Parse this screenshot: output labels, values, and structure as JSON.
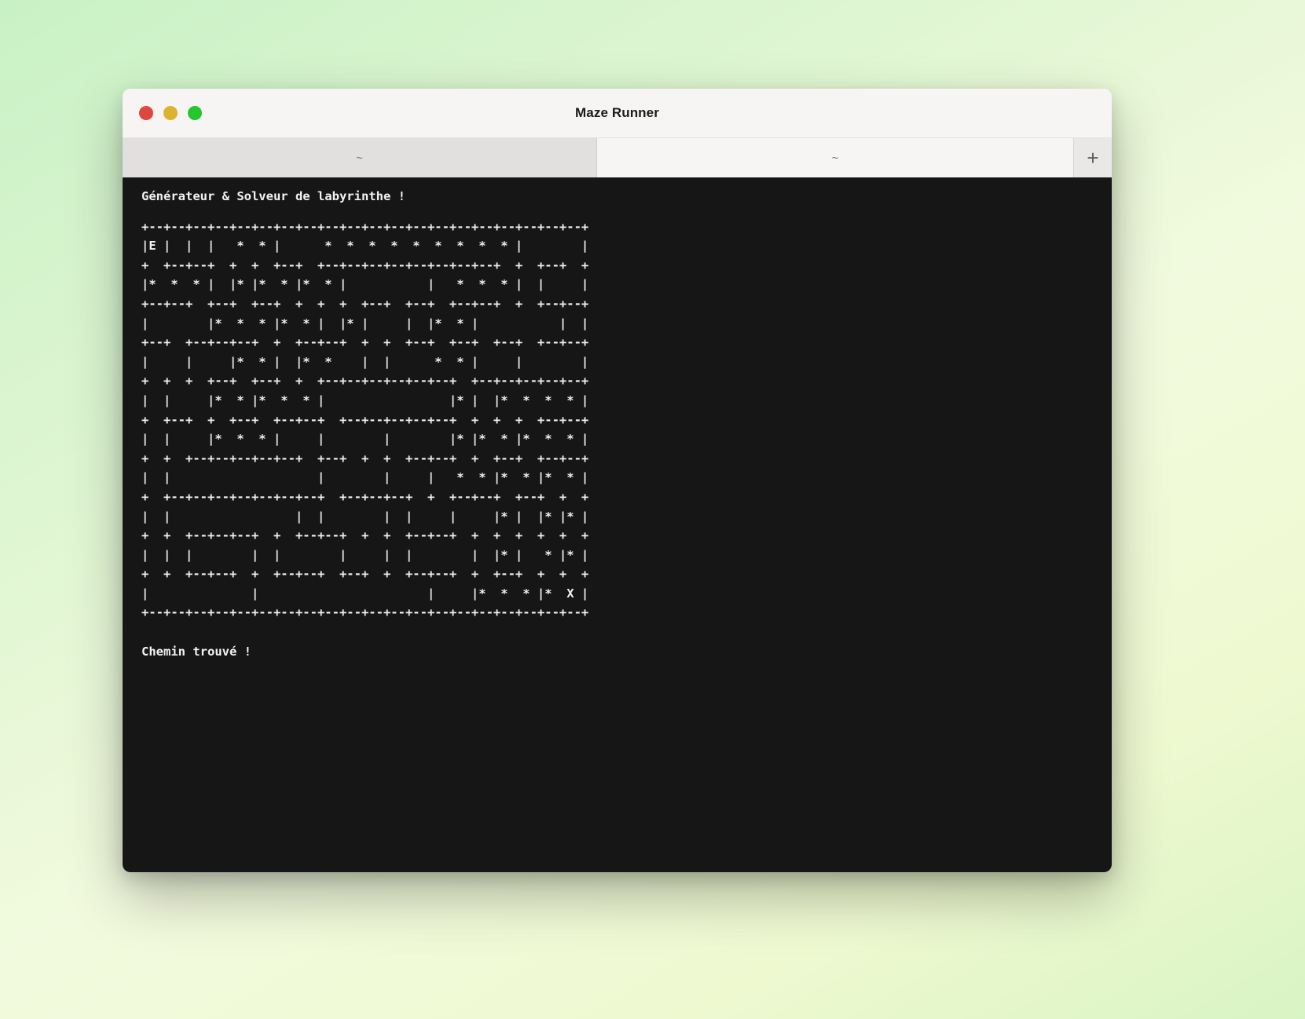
{
  "window": {
    "title": "Maze Runner"
  },
  "traffic_lights": {
    "red": "#e0453f",
    "yellow": "#dcb32f",
    "green": "#25c72f"
  },
  "tabs": {
    "active_label": "~",
    "inactive_label": "~",
    "new_tab_label": "+"
  },
  "terminal": {
    "greeting": "Générateur & Solveur de labyrinthe !",
    "maze_rows": [
      "+--+--+--+--+--+--+--+--+--+--+--+--+--+--+--+--+--+--+--+--+",
      "|E |  |  |   *  * |      *  *  *  *  *  *  *  *  * |        |",
      "+  +--+--+  +  +  +--+  +--+--+--+--+--+--+--+--+  +  +--+  +",
      "|*  *  * |  |* |*  * |*  * |           |   *  *  * |  |     |",
      "+--+--+  +--+  +--+  +  +  +  +--+  +--+  +--+--+  +  +--+--+",
      "|        |*  *  * |*  * |  |* |     |  |*  * |           |  |",
      "+--+  +--+--+--+  +  +--+--+  +  +  +--+  +--+  +--+  +--+--+",
      "|     |     |*  * |  |*  *    |  |      *  * |     |        |",
      "+  +  +  +--+  +--+  +  +--+--+--+--+--+--+  +--+--+--+--+--+",
      "|  |     |*  * |*  *  * |                 |* |  |*  *  *  * |",
      "+  +--+  +  +--+  +--+--+  +--+--+--+--+--+  +  +  +  +--+--+",
      "|  |     |*  *  * |     |        |        |* |*  * |*  *  * |",
      "+  +  +--+--+--+--+--+  +--+  +  +  +--+--+  +  +--+  +--+--+",
      "|  |                    |        |     |   *  * |*  * |*  * |",
      "+  +--+--+--+--+--+--+--+  +--+--+--+  +  +--+--+  +--+  +  +",
      "|  |                 |  |        |  |     |     |* |  |* |* |",
      "+  +  +--+--+--+  +  +--+--+  +  +  +--+--+  +  +  +  +  +  +",
      "|  |  |        |  |        |     |  |        |  |* |   * |* |",
      "+  +  +--+--+  +  +--+--+  +--+  +  +--+--+  +  +--+  +  +  +",
      "|              |                       |     |*  *  * |*  X |",
      "+--+--+--+--+--+--+--+--+--+--+--+--+--+--+--+--+--+--+--+--+"
    ],
    "result": "Chemin trouvé !"
  }
}
